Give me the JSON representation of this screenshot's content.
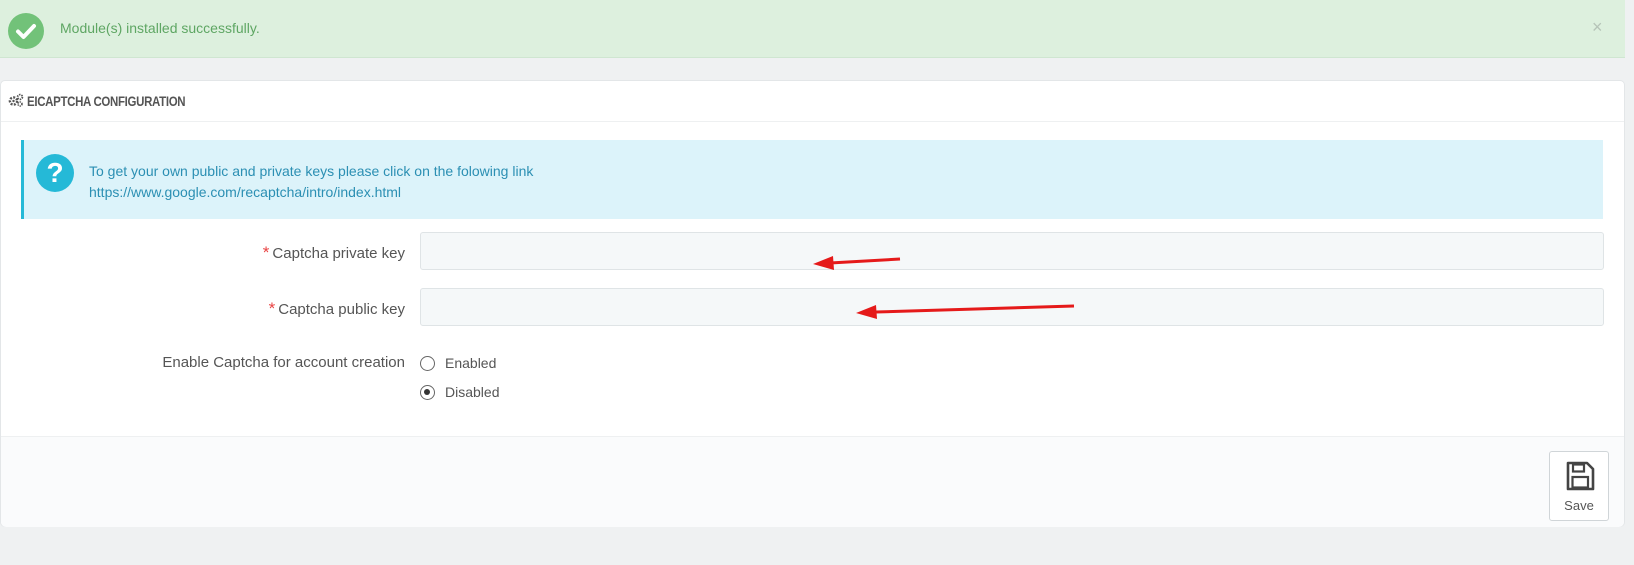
{
  "alert": {
    "message": "Module(s) installed successfully.",
    "close_glyph": "×"
  },
  "panel": {
    "title": "EICAPTCHA CONFIGURATION"
  },
  "info": {
    "text": "To get your own public and private keys please click on the folowing link",
    "link": "https://www.google.com/recaptcha/intro/index.html",
    "icon_glyph": "?"
  },
  "form": {
    "private_key": {
      "required_mark": "*",
      "label": "Captcha private key",
      "value": ""
    },
    "public_key": {
      "required_mark": "*",
      "label": "Captcha public key",
      "value": ""
    },
    "account_creation": {
      "label": "Enable Captcha for account creation",
      "options": [
        "Enabled",
        "Disabled"
      ],
      "selected": "Disabled"
    }
  },
  "footer": {
    "save_label": "Save"
  },
  "icons": {
    "success": "check-circle-icon",
    "heading": "cogs-icon",
    "info": "question-circle-icon",
    "save": "floppy-disk-icon",
    "close": "close-icon"
  },
  "colors": {
    "success_bg": "#ddf0de",
    "success_text": "#5ea663",
    "info_bg": "#dcf3fa",
    "info_accent": "#25b9d7",
    "required": "#e94343",
    "annotation_arrow": "#e51a1a"
  }
}
